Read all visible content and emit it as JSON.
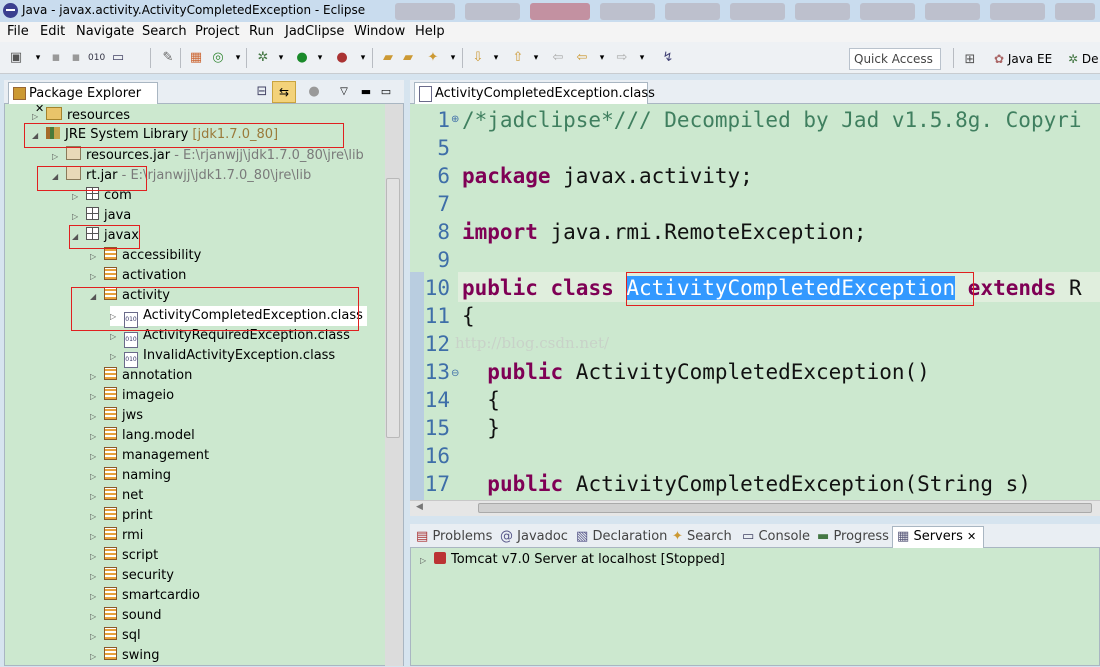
{
  "window": {
    "title": "Java - javax.activity.ActivityCompletedException - Eclipse"
  },
  "menu": [
    "File",
    "Edit",
    "Navigate",
    "Search",
    "Project",
    "Run",
    "JadClipse",
    "Window",
    "Help"
  ],
  "toolbar": {
    "quick_access": "Quick Access",
    "perspective_java_ee": "Java EE",
    "perspective_debug": "De"
  },
  "package_explorer": {
    "tab": "Package Explorer",
    "rows": [
      {
        "label": "resources",
        "suffix": ""
      },
      {
        "label": "JRE System Library",
        "suffix": "[jdk1.7.0_80]"
      },
      {
        "label": "resources.jar",
        "suffix": "- E:\\rjanwjj\\jdk1.7.0_80\\jre\\lib"
      },
      {
        "label": "rt.jar",
        "suffix": "- E:\\rjanwjj\\jdk1.7.0_80\\jre\\lib"
      },
      {
        "label": "com",
        "suffix": ""
      },
      {
        "label": "java",
        "suffix": ""
      },
      {
        "label": "javax",
        "suffix": ""
      },
      {
        "label": "accessibility",
        "suffix": ""
      },
      {
        "label": "activation",
        "suffix": ""
      },
      {
        "label": "activity",
        "suffix": ""
      },
      {
        "label": "ActivityCompletedException.class",
        "suffix": ""
      },
      {
        "label": "ActivityRequiredException.class",
        "suffix": ""
      },
      {
        "label": "InvalidActivityException.class",
        "suffix": ""
      },
      {
        "label": "annotation",
        "suffix": ""
      },
      {
        "label": "imageio",
        "suffix": ""
      },
      {
        "label": "jws",
        "suffix": ""
      },
      {
        "label": "lang.model",
        "suffix": ""
      },
      {
        "label": "management",
        "suffix": ""
      },
      {
        "label": "naming",
        "suffix": ""
      },
      {
        "label": "net",
        "suffix": ""
      },
      {
        "label": "print",
        "suffix": ""
      },
      {
        "label": "rmi",
        "suffix": ""
      },
      {
        "label": "script",
        "suffix": ""
      },
      {
        "label": "security",
        "suffix": ""
      },
      {
        "label": "smartcardio",
        "suffix": ""
      },
      {
        "label": "sound",
        "suffix": ""
      },
      {
        "label": "sql",
        "suffix": ""
      },
      {
        "label": "swing",
        "suffix": ""
      }
    ]
  },
  "editor": {
    "tab": "ActivityCompletedException.class",
    "line_numbers": [
      "1",
      "5",
      "6",
      "7",
      "8",
      "9",
      "10",
      "11",
      "12",
      "13",
      "14",
      "15",
      "16",
      "17"
    ],
    "code": {
      "l1": "/*jadclipse*/// Decompiled by Jad v1.5.8g. Copyri",
      "l6_kw": "package",
      "l6": " javax.activity;",
      "l8_kw": "import",
      "l8": " java.rmi.RemoteException;",
      "l10_kw1": "public",
      "l10_kw2": "class",
      "l10_sel": "ActivityCompletedException",
      "l10_kw3": "extends",
      "l10_rest": "R",
      "l11": "{",
      "l13_kw": "public",
      "l13": " ActivityCompletedException()",
      "l14": "{",
      "l15": "}",
      "l17_kw": "public",
      "l17": " ActivityCompletedException(String s)"
    },
    "watermark": "http://blog.csdn.net/"
  },
  "bottom_panel": {
    "tabs": [
      "Problems",
      "Javadoc",
      "Declaration",
      "Search",
      "Console",
      "Progress",
      "Servers"
    ],
    "server_row": "Tomcat v7.0 Server at localhost  [Stopped]"
  }
}
